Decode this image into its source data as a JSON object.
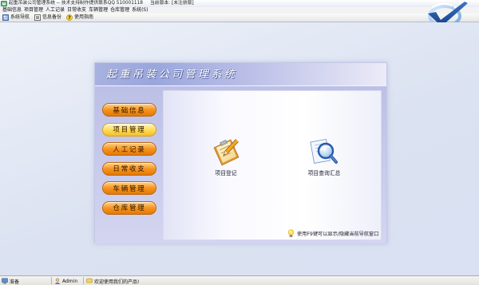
{
  "window": {
    "title": "起重吊装公司管理系统 -- 技术支持制作提供联系QQ 510001118",
    "version": "当前版本: [未注册版]",
    "app_icon": "app-icon"
  },
  "menu": [
    "基础信息",
    "项目管理",
    "人工记录",
    "日常收支",
    "车辆管理",
    "仓库管理",
    "系统(S)"
  ],
  "toolbar": [
    {
      "label": "系统导航",
      "icon": "navigator-icon"
    },
    {
      "label": "信息备份",
      "icon": "backup-icon"
    },
    {
      "label": "使用指南",
      "icon": "help-icon"
    }
  ],
  "logo": {
    "icon": "checkmark-logo-icon"
  },
  "panel": {
    "title": "起重吊装公司管理系统",
    "nav": [
      {
        "label": "基础信息",
        "selected": false
      },
      {
        "label": "项目管理",
        "selected": true
      },
      {
        "label": "人工记录",
        "selected": false
      },
      {
        "label": "日常收支",
        "selected": false
      },
      {
        "label": "车辆管理",
        "selected": false
      },
      {
        "label": "仓库管理",
        "selected": false
      }
    ],
    "items": [
      {
        "label": "项目登记",
        "icon": "clipboard-pencil-icon"
      },
      {
        "label": "项目查询汇总",
        "icon": "document-search-icon"
      }
    ],
    "tip": {
      "icon": "lightbulb-icon",
      "text": "使用F9键可以显示/隐藏当前导航窗口"
    }
  },
  "status": {
    "state": "准备",
    "user": "Admin",
    "message": "欢迎使用我们的产品!"
  },
  "colors": {
    "background": "#d9e1f2",
    "header_band": "#9aa6dc",
    "nav_button": "#f7941d",
    "nav_button_selected": "#ffd84a"
  }
}
